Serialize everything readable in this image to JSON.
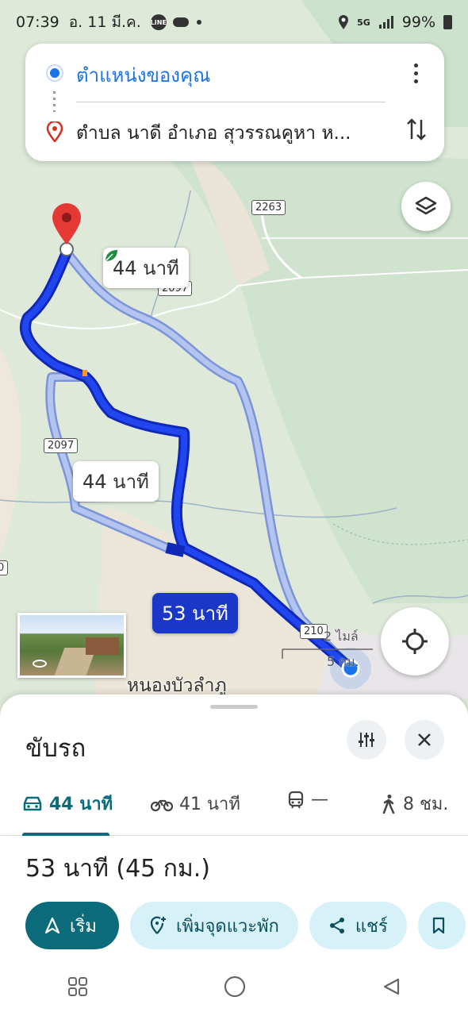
{
  "status_bar": {
    "time": "07:39",
    "date": "อ. 11 มี.ค.",
    "line_icon": "LINE",
    "network": "5G",
    "battery": "99%"
  },
  "search": {
    "origin": "ตำแหน่งของคุณ",
    "destination": "ตำบล นาดี อำเภอ สุวรรณคูหา ห...",
    "icons": {
      "origin": "blue-dot-icon",
      "destination": "red-pin-icon",
      "more": "more-vertical-icon",
      "swap": "swap-icon"
    }
  },
  "map": {
    "route_labels": [
      {
        "text": "44 นาที",
        "eco": true
      },
      {
        "text": "44 นาที",
        "eco": false
      },
      {
        "text": "53 นาที",
        "eco": false,
        "selected": true
      }
    ],
    "road_shields": [
      "2263",
      "2097",
      "2097",
      "210",
      "0"
    ],
    "place": "หนองบัวลำภู",
    "scale": {
      "miles": "2 ไมล์",
      "km": "5 กม."
    },
    "colors": {
      "selected_route": "#1a37c8",
      "alt_route": "#aabbe8"
    }
  },
  "sheet": {
    "title": "ขับรถ",
    "modes": [
      {
        "icon": "car-icon",
        "label": "44 นาที",
        "active": true
      },
      {
        "icon": "motorcycle-icon",
        "label": "41 นาที",
        "active": false
      },
      {
        "icon": "transit-icon",
        "label": "—",
        "active": false
      },
      {
        "icon": "walk-icon",
        "label": "8 ชม.",
        "active": false
      }
    ],
    "summary": "53 นาที (45 กม.)",
    "actions": {
      "start": "เริ่ม",
      "add_stop": "เพิ่มจุดแวะพัก",
      "share": "แชร์"
    },
    "accent": "#0b6b7a"
  }
}
